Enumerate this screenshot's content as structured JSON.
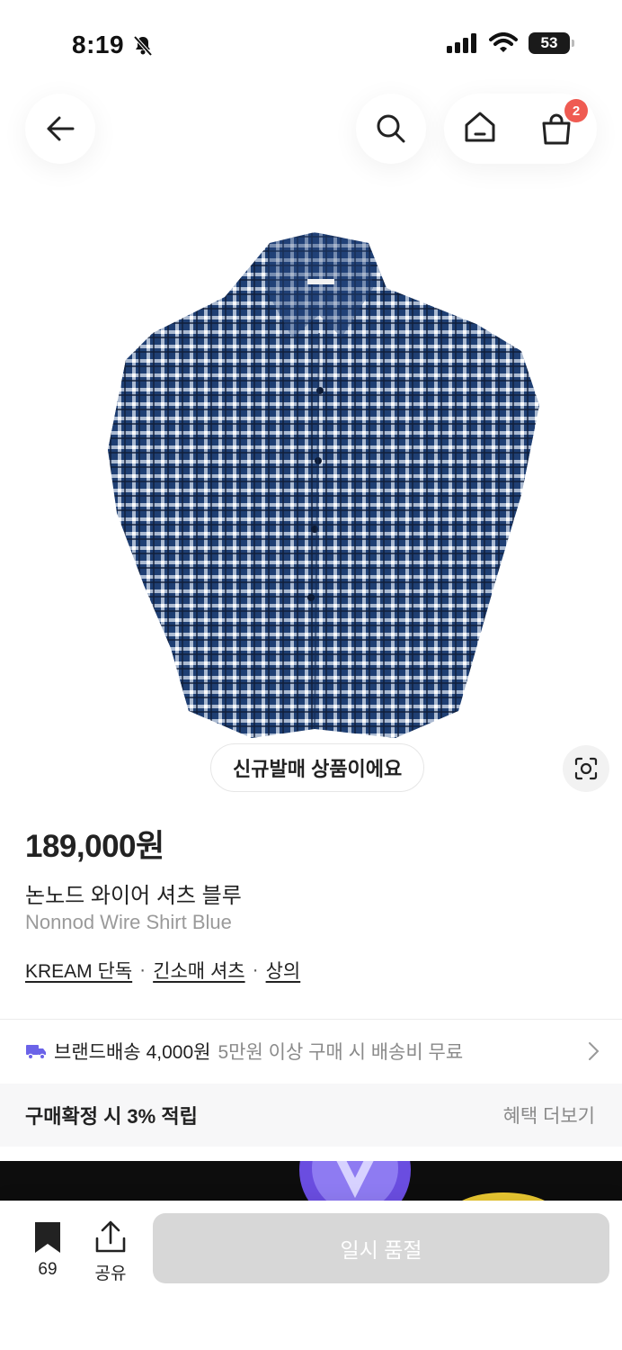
{
  "status_bar": {
    "time": "8:19",
    "battery": "53"
  },
  "nav": {
    "cart_count": "2"
  },
  "product": {
    "badge": "신규발매 상품이에요",
    "price": "189,000원",
    "name_ko": "논노드 와이어 셔츠 블루",
    "name_en": "Nonnod Wire Shirt Blue",
    "breadcrumbs": [
      "KREAM 단독",
      "긴소매 셔츠",
      "상의"
    ]
  },
  "shipping": {
    "label": "브랜드배송",
    "fee": "4,000원",
    "note": "5만원 이상 구매 시 배송비 무료"
  },
  "benefit": {
    "left": "구매확정 시 3% 적립",
    "right": "혜택 더보기"
  },
  "bottom": {
    "save_count": "69",
    "share_label": "공유",
    "main_button": "일시 품절"
  },
  "colors": {
    "badge_red": "#ef5b52",
    "shipping_purple": "#6b63e8",
    "disabled_button": "#d7d7d7",
    "benefit_bg": "#f7f7f8"
  }
}
